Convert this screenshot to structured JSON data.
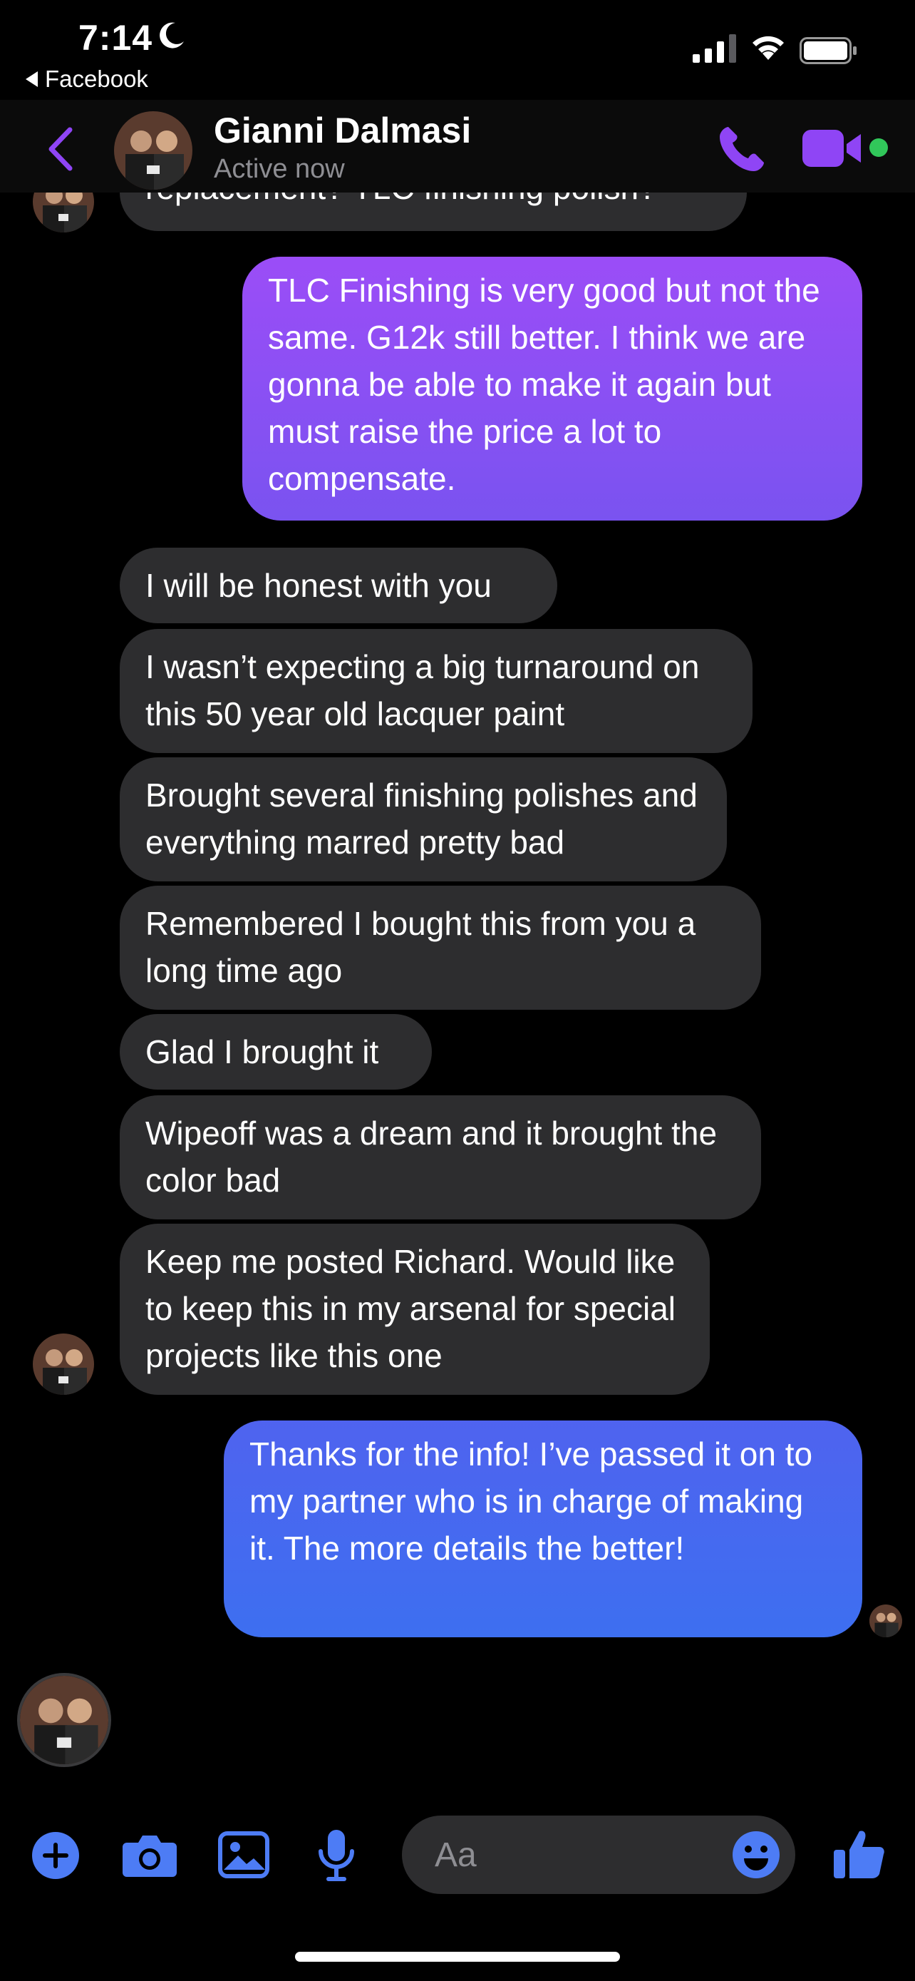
{
  "status_bar": {
    "time": "7:14",
    "back_app": "Facebook"
  },
  "header": {
    "name": "Gianni Dalmasi",
    "status": "Active now"
  },
  "messages": [
    {
      "sender": "contact",
      "text": "replacement?  TLC finishing polish?"
    },
    {
      "sender": "me",
      "text": "TLC Finishing is very good but not the same. G12k still better.  I think we are gonna be able to make it again but must raise the price a lot to compensate."
    },
    {
      "sender": "contact",
      "text": "I will be honest with you"
    },
    {
      "sender": "contact",
      "text": "I wasn’t expecting a big turnaround on this 50 year old lacquer paint"
    },
    {
      "sender": "contact",
      "text": "Brought several finishing polishes and everything marred pretty bad"
    },
    {
      "sender": "contact",
      "text": "Remembered I bought this from you a long time ago"
    },
    {
      "sender": "contact",
      "text": "Glad I brought it"
    },
    {
      "sender": "contact",
      "text": "Wipeoff was a dream and it brought the color bad"
    },
    {
      "sender": "contact",
      "text": "Keep me posted Richard.  Would like to keep this in my arsenal for special projects like this one"
    },
    {
      "sender": "me",
      "text": "Thanks for the info!  I’ve passed it on to my partner who is in charge of making it.  The more details the better!"
    }
  ],
  "composer": {
    "placeholder": "Aa"
  },
  "colors": {
    "accent_purple": "#9b4df7",
    "accent_blue": "#3d6ff0",
    "received_bubble": "#2d2d2f",
    "active_green": "#31c75a"
  },
  "icons": [
    "back-icon",
    "phone-icon",
    "video-icon",
    "plus-icon",
    "camera-icon",
    "gallery-icon",
    "microphone-icon",
    "emoji-icon",
    "thumbs-up-icon"
  ]
}
